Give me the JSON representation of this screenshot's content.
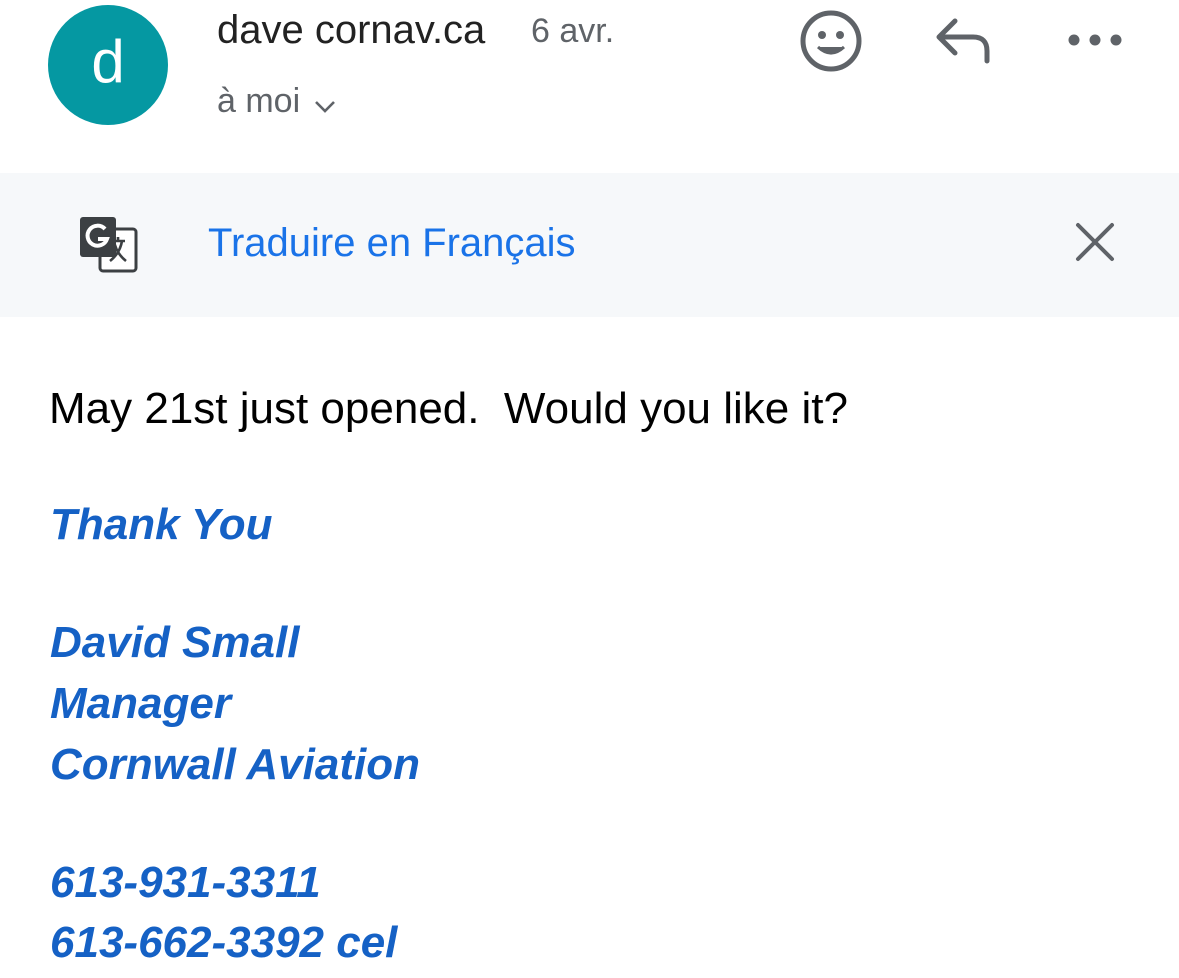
{
  "header": {
    "avatar_letter": "d",
    "sender_name": "dave cornav.ca",
    "date": "6 avr.",
    "recipient": "à moi",
    "icons": {
      "emoji": "emoji-smile-icon",
      "reply": "reply-icon",
      "more": "more-horizontal-icon",
      "recipient_expand": "chevron-down-icon"
    }
  },
  "translate": {
    "icon": "google-translate-icon",
    "link_label": "Traduire en Français",
    "close_icon": "close-icon"
  },
  "message": {
    "body": "May 21st just opened.  Would you like it?",
    "signature": {
      "closing": "Thank You",
      "name": "David Small",
      "title": "Manager",
      "company": "Cornwall Aviation",
      "phone": "613-931-3311",
      "cell": "613-662-3392 cel"
    }
  },
  "colors": {
    "avatar_bg": "#0598a2",
    "link": "#1a73e8",
    "signature": "#1561c5",
    "translate_bar_bg": "#f6f8fa"
  }
}
